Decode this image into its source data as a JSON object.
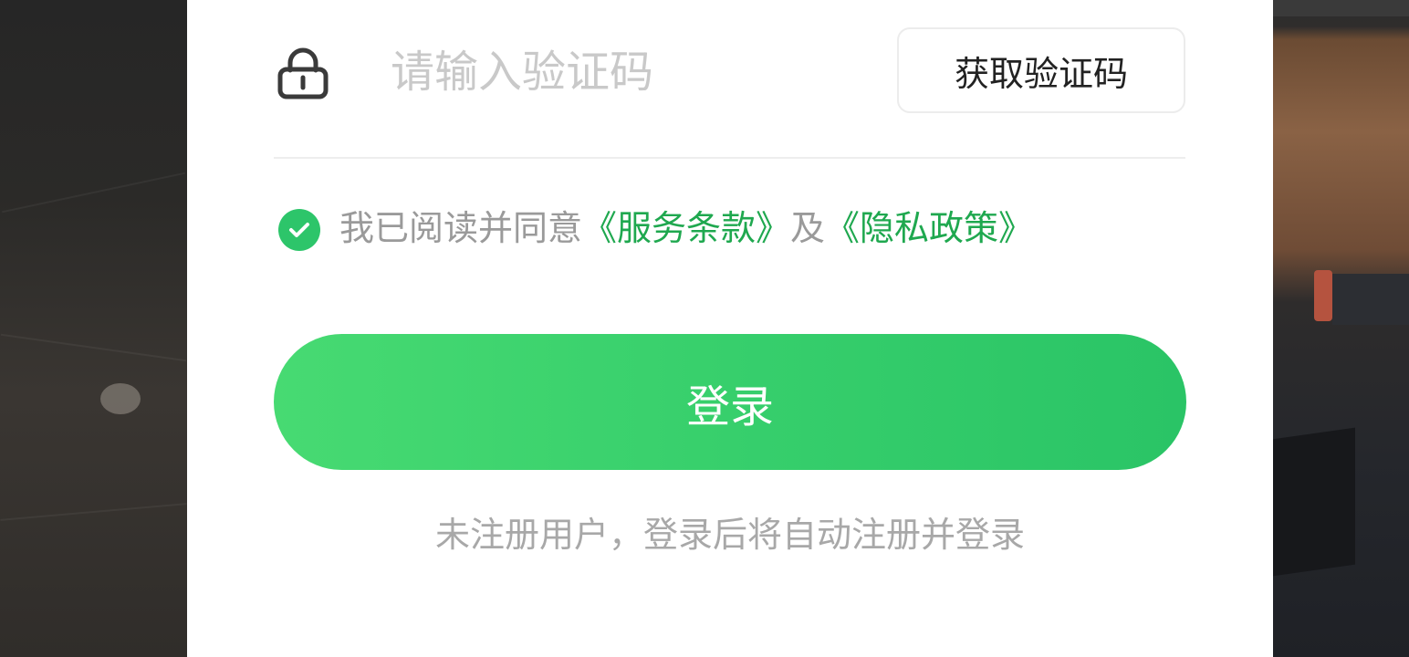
{
  "form": {
    "code_placeholder": "请输入验证码",
    "get_code_label": "获取验证码"
  },
  "agreement": {
    "checked": true,
    "prefix": "我已阅读并同意",
    "terms_link": "《服务条款》",
    "conjunction": "及",
    "privacy_link": "《隐私政策》"
  },
  "login": {
    "button_label": "登录",
    "note": "未注册用户，登录后将自动注册并登录"
  },
  "colors": {
    "accent": "#2dc56a",
    "link": "#1fa84f",
    "button_start": "#47da72",
    "button_end": "#2ac466"
  },
  "icons": {
    "lock": "lock-icon",
    "check": "check-icon"
  }
}
